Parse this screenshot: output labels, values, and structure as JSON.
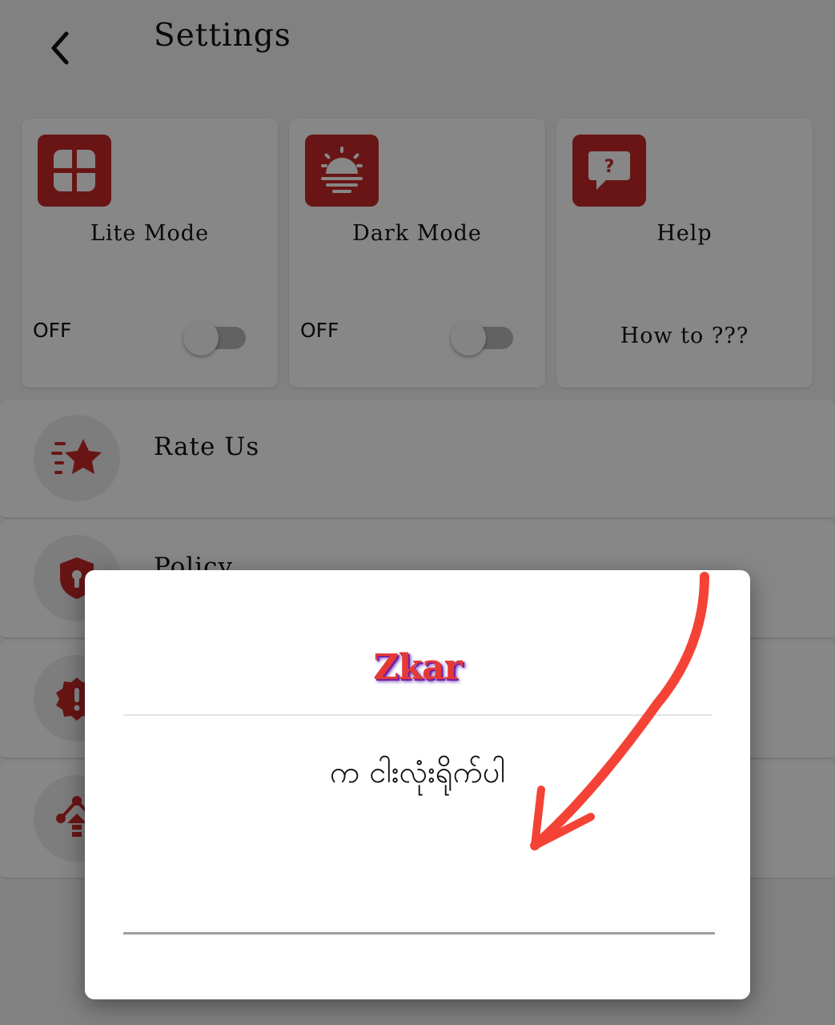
{
  "header": {
    "title": "Settings",
    "back_icon": "chevron-left-icon"
  },
  "cards": [
    {
      "title": "Lite Mode",
      "status": "OFF",
      "icon": "grid-icon",
      "toggle_on": false
    },
    {
      "title": "Dark Mode",
      "status": "OFF",
      "icon": "sunset-icon",
      "toggle_on": false
    },
    {
      "title": "Help",
      "subtitle": "How to ???",
      "icon": "help-chat-icon"
    }
  ],
  "list": [
    {
      "label": "Rate Us",
      "icon": "star-rate-icon"
    },
    {
      "label": "Policy",
      "icon": "shield-lock-icon"
    },
    {
      "label": "",
      "icon": "alert-badge-icon"
    },
    {
      "label": "",
      "icon": "share-network-icon"
    }
  ],
  "dialog": {
    "brand": "Zkar",
    "message": "က ငါးလုံးရိုက်ပါ",
    "input_value": ""
  },
  "colors": {
    "accent": "#c62828",
    "brand": "#e53935",
    "annotation": "#f44336"
  }
}
